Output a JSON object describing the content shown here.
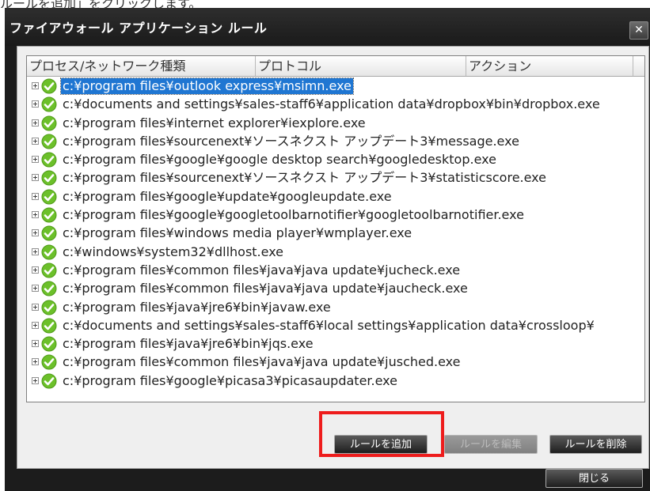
{
  "top_caption": "ルールを追加」をクリックします。",
  "dialog": {
    "title": "ファイアウォール アプリケーション ルール",
    "close_glyph": "✕"
  },
  "list": {
    "columns": [
      "プロセス/ネットワーク種類",
      "プロトコル",
      "アクション"
    ],
    "selected_index": 0,
    "rows": [
      "c:¥program files¥outlook express¥msimn.exe",
      "c:¥documents and settings¥sales-staff6¥application data¥dropbox¥bin¥dropbox.exe",
      "c:¥program files¥internet explorer¥iexplore.exe",
      "c:¥program files¥sourcenext¥ソースネクスト アップデート3¥message.exe",
      "c:¥program files¥google¥google desktop search¥googledesktop.exe",
      "c:¥program files¥sourcenext¥ソースネクスト アップデート3¥statisticscore.exe",
      "c:¥program files¥google¥update¥googleupdate.exe",
      "c:¥program files¥google¥googletoolbarnotifier¥googletoolbarnotifier.exe",
      "c:¥program files¥windows media player¥wmplayer.exe",
      "c:¥windows¥system32¥dllhost.exe",
      "c:¥program files¥common files¥java¥java update¥jucheck.exe",
      "c:¥program files¥common files¥java¥java update¥jaucheck.exe",
      "c:¥program files¥java¥jre6¥bin¥javaw.exe",
      "c:¥documents and settings¥sales-staff6¥local settings¥application data¥crossloop¥",
      "c:¥program files¥java¥jre6¥bin¥jqs.exe",
      "c:¥program files¥common files¥java¥java update¥jusched.exe",
      "c:¥program files¥google¥picasa3¥picasaupdater.exe"
    ]
  },
  "buttons": {
    "add_rule": "ルールを追加",
    "edit_rule": "ルールを編集",
    "delete_rule": "ルールを削除",
    "close": "閉じる"
  },
  "icons": {
    "row_status": "check-circle-icon",
    "expander": "plus-box-icon"
  },
  "colors": {
    "selection": "#1f76d2",
    "check_green": "#6cc02a",
    "highlight_red": "#ee1c1c",
    "dialog_bg": "#1c1c1c"
  }
}
